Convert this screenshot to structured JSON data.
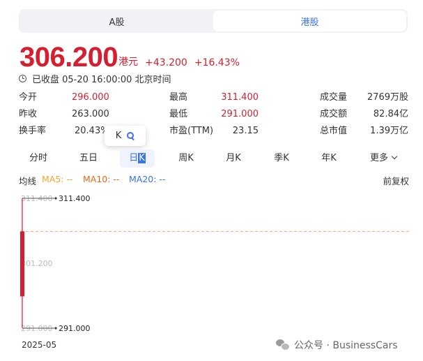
{
  "market_tabs": [
    {
      "label": "A股",
      "active": false
    },
    {
      "label": "港股",
      "active": true
    }
  ],
  "quote": {
    "price": "306.200",
    "currency": "港元",
    "change": "+43.200",
    "change_pct": "+16.43%",
    "status": "已收盘 05-20 16:00:00 北京时间"
  },
  "stats": {
    "open_label": "今开",
    "open_value": "296.000",
    "high_label": "最高",
    "high_value": "311.400",
    "volume_label": "成交量",
    "volume_value": "2769万股",
    "prev_close_label": "昨收",
    "prev_close_value": "263.000",
    "low_label": "最低",
    "low_value": "291.000",
    "turnover_label": "成交额",
    "turnover_value": "82.84亿",
    "turnover_rate_label": "换手率",
    "turnover_rate_value": "20.43%",
    "pe_label": "市盈(TTM)",
    "pe_value": "23.15",
    "market_cap_label": "总市值",
    "market_cap_value": "1.39万亿"
  },
  "tooltip": {
    "text": "K"
  },
  "period_tabs": {
    "intraday": "分时",
    "five_day": "五日",
    "daily_prefix": "日",
    "daily_selected": "K",
    "weekly": "周K",
    "monthly": "月K",
    "quarterly": "季K",
    "yearly": "年K",
    "more": "更多"
  },
  "ma": {
    "label": "均线",
    "ma5": "MA5: --",
    "ma10": "MA10: --",
    "ma20": "MA20: --",
    "adjust": "前复权",
    "colors": {
      "ma5": "#f5a623",
      "ma10": "#e8641b",
      "ma20": "#3a6ff7"
    }
  },
  "chart_data": {
    "type": "candlestick",
    "y_ticks": [
      "311.400",
      "301.200",
      "291.000"
    ],
    "ylim": [
      291.0,
      311.4
    ],
    "high_label": "311.400",
    "low_label": "291.000",
    "x_label": "2025-05",
    "candles": [
      {
        "date": "2025-05-20",
        "open": 296.0,
        "close": 306.2,
        "high": 311.4,
        "low": 291.0
      }
    ],
    "reference_line": 306.2,
    "colors": {
      "up": "#d41f31",
      "ref_line": "#f2a48f"
    }
  },
  "watermark": {
    "text": "公众号 · BusinessCars"
  }
}
